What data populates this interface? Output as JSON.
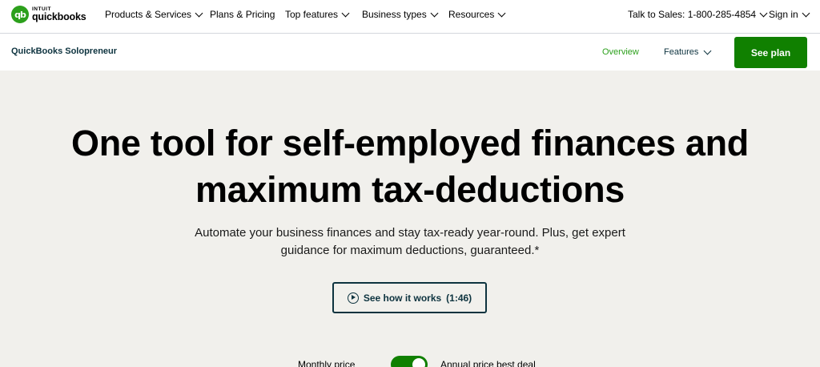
{
  "brand": {
    "top": "INTUIT",
    "name": "quickbooks",
    "mark": "qb"
  },
  "topnav": {
    "items": [
      {
        "label": "Products & Services"
      },
      {
        "label": "Plans & Pricing"
      },
      {
        "label": "Top features"
      },
      {
        "label": "Business types"
      },
      {
        "label": "Resources"
      }
    ],
    "phone": "Talk to Sales: 1-800-285-4854",
    "signin": "Sign in"
  },
  "subnav": {
    "title": "QuickBooks Solopreneur",
    "overview": "Overview",
    "features": "Features",
    "cta": "See plan"
  },
  "hero": {
    "headline_line1": "One tool for self-employed finances and",
    "headline_line2": "maximum tax-deductions",
    "sub_line1": "Automate your business finances and stay tax-ready year-round. Plus, get expert",
    "sub_line2": "guidance for maximum deductions, guaranteed.*",
    "video_label": "See how it works",
    "video_duration": "(1:46)"
  },
  "pricing_toggle": {
    "left": "Monthly price",
    "right": "Annual price best deal",
    "state": "annual"
  },
  "colors": {
    "brand_green": "#2ca01c",
    "cta_green": "#108000",
    "hero_bg": "#f1f0ec"
  }
}
